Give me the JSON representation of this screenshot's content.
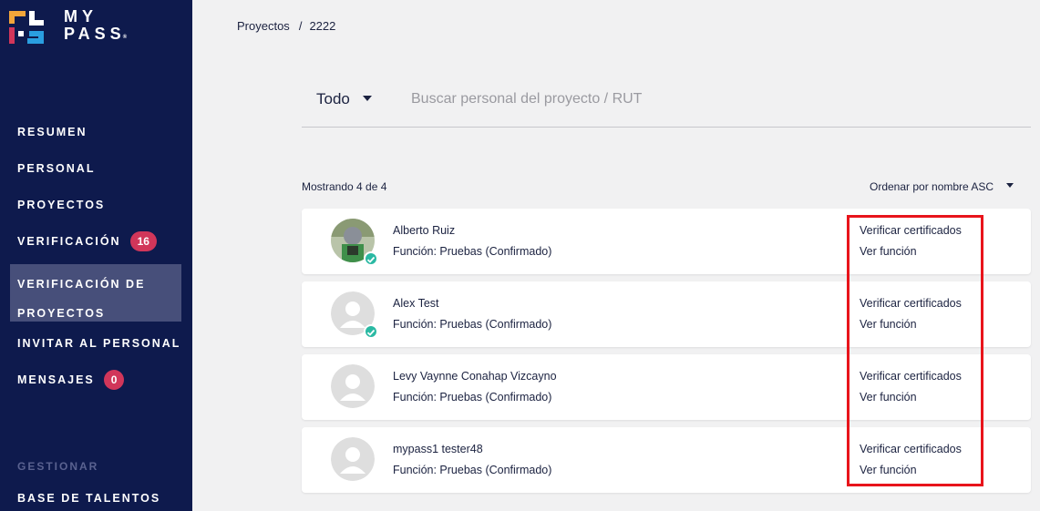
{
  "brand": {
    "line1": "MY",
    "line2": "PASS",
    "reg": "®"
  },
  "sidebar": {
    "items": [
      {
        "label": "RESUMEN"
      },
      {
        "label": "PERSONAL"
      },
      {
        "label": "PROYECTOS"
      },
      {
        "label": "VERIFICACIÓN",
        "badge": "16"
      },
      {
        "label": "VERIFICACIÓN DE PROYECTOS",
        "active": true
      },
      {
        "label": "INVITAR AL PERSONAL"
      },
      {
        "label": "MENSAJES",
        "badge": "0"
      }
    ],
    "section": "GESTIONAR",
    "section_items": [
      {
        "label": "BASE DE TALENTOS"
      }
    ]
  },
  "breadcrumb": {
    "parent": "Proyectos",
    "separator": "/",
    "current": "2222"
  },
  "filter": {
    "selected": "Todo",
    "search_placeholder": "Buscar personal del proyecto / RUT",
    "search_value": ""
  },
  "list": {
    "showing": "Mostrando 4 de 4",
    "sort_label": "Ordenar por nombre ASC",
    "action_verify": "Verificar certificados",
    "action_view": "Ver función",
    "people": [
      {
        "name": "Alberto Ruiz",
        "role": "Función: Pruebas (Confirmado)",
        "verified": true,
        "photo": true
      },
      {
        "name": "Alex Test",
        "role": "Función: Pruebas (Confirmado)",
        "verified": true,
        "photo": false
      },
      {
        "name": "Levy Vaynne Conahap Vizcayno",
        "role": "Función: Pruebas (Confirmado)",
        "verified": false,
        "photo": false
      },
      {
        "name": "mypass1 tester48",
        "role": "Función: Pruebas (Confirmado)",
        "verified": false,
        "photo": false
      }
    ]
  },
  "colors": {
    "sidebar": "#0e1a4d",
    "active": "#474f7a",
    "badge": "#d1365a",
    "verified": "#2ab9a3",
    "highlight": "#e8141b"
  }
}
